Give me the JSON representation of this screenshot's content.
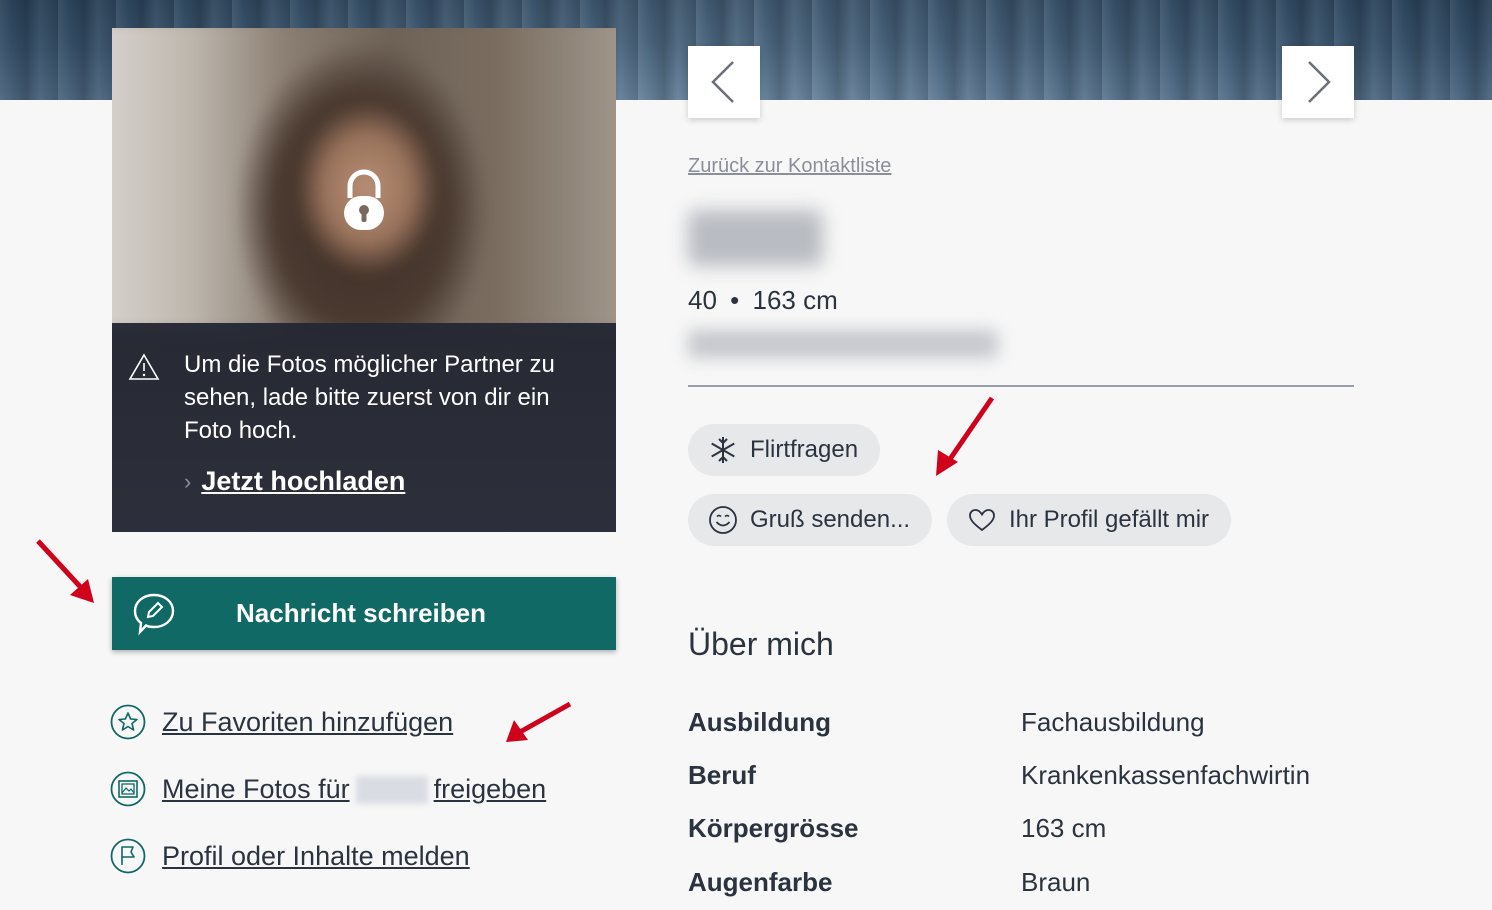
{
  "nav": {
    "prev_icon": "chevron-left-icon",
    "next_icon": "chevron-right-icon"
  },
  "photo_notice": {
    "message": "Um die Fotos möglicher Partner zu sehen, lade bitte zuerst von dir ein Foto hoch.",
    "upload_label": "Jetzt hochladen"
  },
  "actions": {
    "message_button": "Nachricht schreiben",
    "favorite_link": "Zu Favoriten hinzufügen",
    "share_photos_prefix": "Meine Fotos für",
    "share_photos_suffix": "freigeben",
    "report_link": "Profil oder Inhalte melden"
  },
  "profile": {
    "back_link": "Zurück zur Kontaktliste",
    "age": "40",
    "separator": "•",
    "height": "163 cm"
  },
  "chips": {
    "flirt_questions": "Flirtfragen",
    "send_greeting": "Gruß senden...",
    "like_profile": "Ihr Profil gefällt mir"
  },
  "about": {
    "title": "Über mich",
    "rows": [
      {
        "key": "Ausbildung",
        "value": "Fachausbildung"
      },
      {
        "key": "Beruf",
        "value": "Krankenkassenfachwirtin"
      },
      {
        "key": "Körpergrösse",
        "value": "163 cm"
      },
      {
        "key": "Augenfarbe",
        "value": "Braun"
      }
    ]
  },
  "colors": {
    "primary_button": "#116966",
    "annotation_arrow": "#d0021b",
    "notice_bg": "#24283a"
  }
}
